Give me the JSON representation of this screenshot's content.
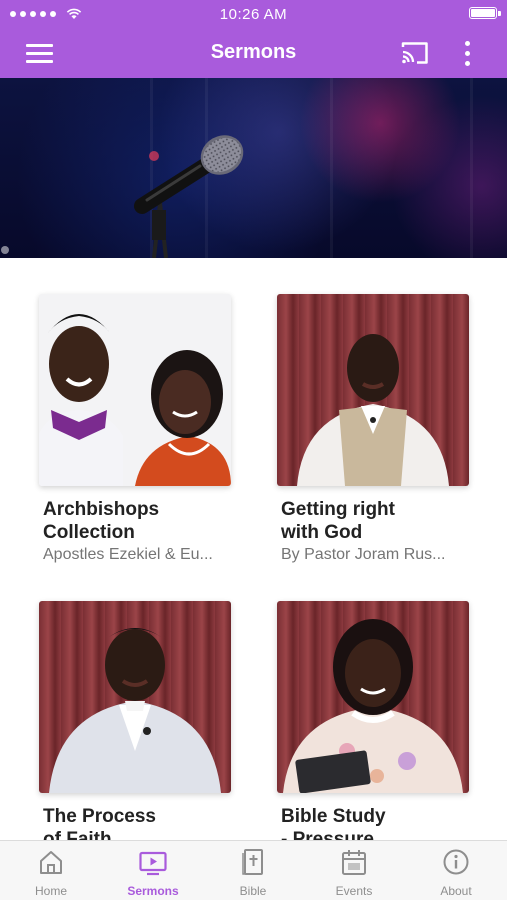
{
  "status_bar": {
    "time": "10:26 AM"
  },
  "header": {
    "title": "Sermons"
  },
  "sermons": [
    {
      "title": "Archbishops\nCollection",
      "subtitle": "Apostles Ezekiel & Eu..."
    },
    {
      "title": "Getting right\nwith God",
      "subtitle": "By Pastor Joram Rus..."
    },
    {
      "title": "The Process\nof Faith",
      "subtitle": ""
    },
    {
      "title": "Bible Study\n- Pressure",
      "subtitle": ""
    }
  ],
  "tabs": [
    {
      "label": "Home",
      "icon": "home-icon"
    },
    {
      "label": "Sermons",
      "icon": "sermons-icon",
      "active": true
    },
    {
      "label": "Bible",
      "icon": "bible-icon"
    },
    {
      "label": "Events",
      "icon": "events-icon"
    },
    {
      "label": "About",
      "icon": "about-icon"
    }
  ],
  "colors": {
    "accent": "#a95bdc",
    "tab_inactive": "#8e8e8e"
  }
}
